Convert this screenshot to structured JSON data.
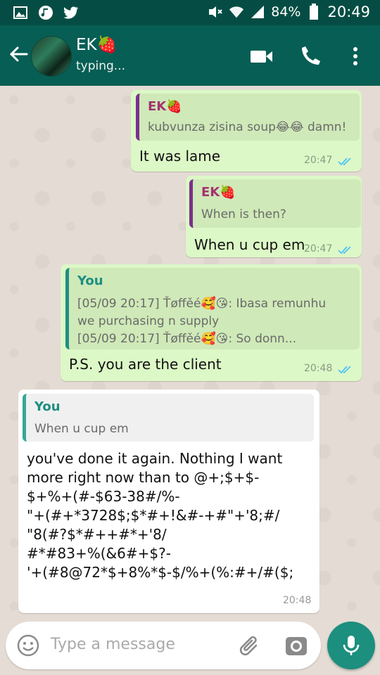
{
  "status_bar": {
    "battery": "84%",
    "clock": "20:49"
  },
  "header": {
    "contact_name": "EK🍓",
    "contact_status": "typing..."
  },
  "messages": [
    {
      "quote_name": "EK🍓",
      "quote_line1": "kubvunza zisina soup😂😂 damn!",
      "text": "It was lame",
      "time": "20:47"
    },
    {
      "quote_name": "EK🍓",
      "quote_line1": "When is then?",
      "text": "When u cup em",
      "time": "20:47"
    },
    {
      "quote_name": "You",
      "quote_line1": "[05/09 20:17] Ťøffěé🥰😘: Ibasa remunhu",
      "quote_line2": "we purchasing n supply",
      "quote_line3": "[05/09 20:17] Ťøffěé🥰😘: So donn...",
      "text": "P.S. you are the client",
      "time": "20:48"
    },
    {
      "quote_name": "You",
      "quote_line1": "When u cup em",
      "lines": [
        "you've done it again. Nothing I want",
        "more right now than to @+;$+$-",
        "$+%+(#-$63-38#/%-",
        "\"+(#+*3728$;$*#+!&#-+#\"+'8;#/",
        "\"8(#?$*#++#*+'8/",
        "#*#83+%(&6#+$?-",
        "'+(#8@72*$+8%*$-$/%+(%:#+/#($;"
      ],
      "time": "20:48"
    }
  ],
  "input": {
    "placeholder": "Type a message"
  },
  "icons": {
    "back": "arrow-left-icon",
    "video": "video-call-icon",
    "phone": "phone-icon",
    "menu": "more-vert-icon",
    "emoji": "emoji-icon",
    "attach": "paperclip-icon",
    "camera": "camera-icon",
    "mic": "mic-icon"
  },
  "colors": {
    "header": "#075e54",
    "status_bar": "#054d44",
    "outgoing_bubble": "#dcf8c6",
    "incoming_bubble": "#ffffff",
    "read_ticks": "#4fc3f7",
    "mic_button": "#1c8f7e"
  }
}
